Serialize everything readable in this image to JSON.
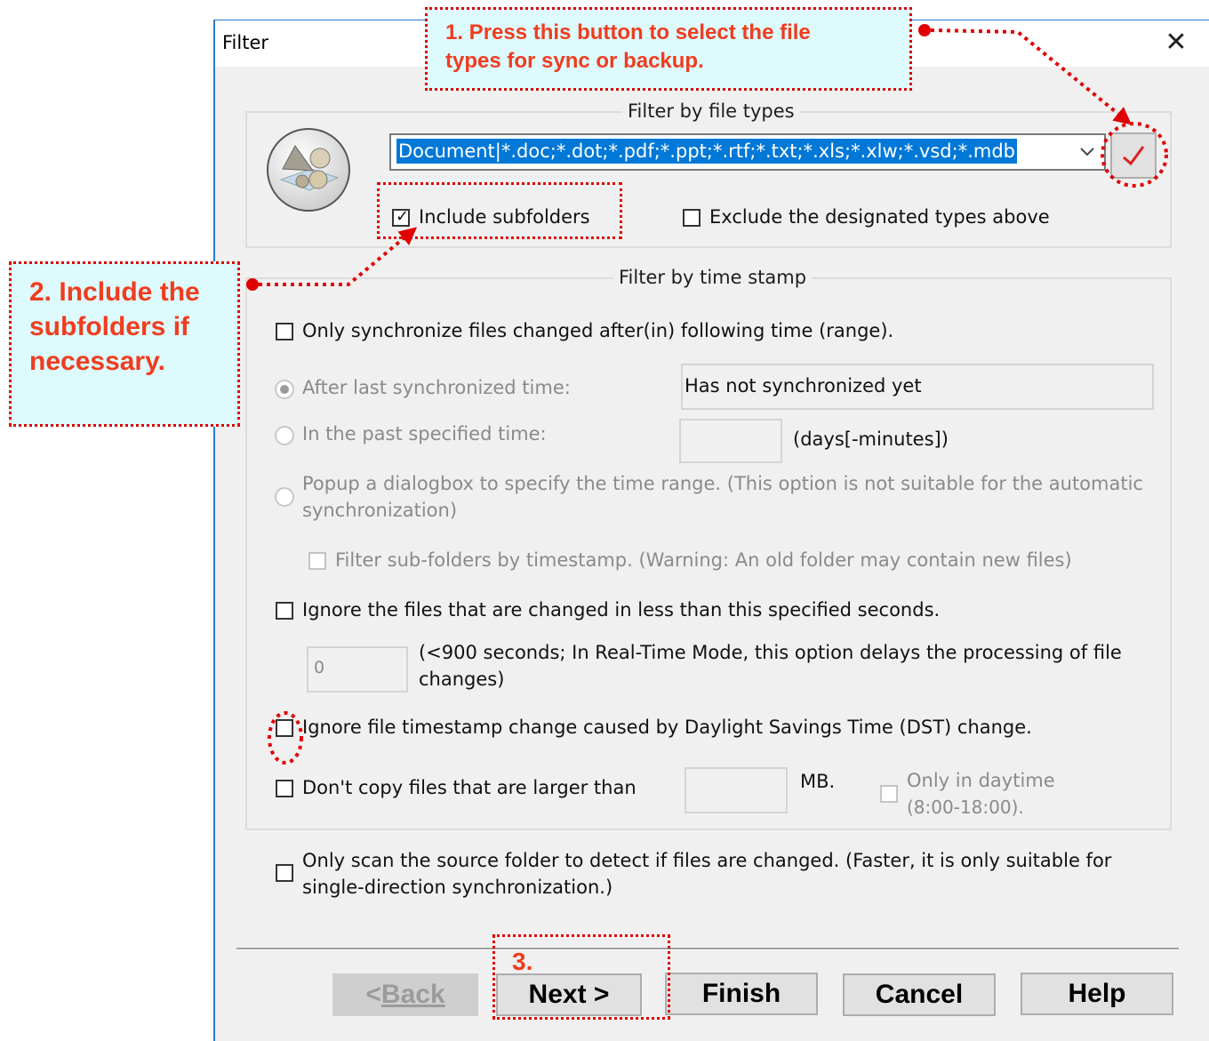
{
  "dialog": {
    "title": "Filter",
    "close_glyph": "✕",
    "file_types": {
      "group_label": "Filter by file types",
      "combo_value": "Document|*.doc;*.dot;*.pdf;*.ppt;*.rtf;*.txt;*.xls;*.xlw;*.vsd;*.mdb",
      "include_subfolders": "Include subfolders",
      "include_subfolders_checked": true,
      "exclude_types": "Exclude the designated types above",
      "exclude_types_checked": false
    },
    "time_stamp": {
      "group_label": "Filter by time stamp",
      "only_sync_changed": "Only synchronize files changed after(in) following time (range).",
      "after_last_sync": "After last synchronized time:",
      "last_sync_value": "Has not synchronized yet",
      "in_past": "In the past specified time:",
      "days_minutes": "(days[-minutes])",
      "popup_line1": "Popup a dialogbox to specify the time range. (This option is not suitable for the automatic",
      "popup_line2": "synchronization)",
      "filter_subfolders": "Filter sub-folders by timestamp. (Warning: An old folder may contain new files)",
      "ignore_seconds": "Ignore the files that are changed in less than this specified seconds.",
      "seconds_value": "0",
      "seconds_note_line1": "(<900 seconds; In Real-Time Mode, this option delays the processing of file",
      "seconds_note_line2": "changes)",
      "ignore_dst": "Ignore file timestamp change caused by Daylight Savings Time (DST) change.",
      "dont_copy_larger": "Don't copy files that are larger than",
      "mb_label": "MB.",
      "daytime_line1": "Only in daytime",
      "daytime_line2": "(8:00-18:00)."
    },
    "scan_source_line1": "Only scan the source folder to detect if files are changed. (Faster, it is only suitable for",
    "scan_source_line2": "single-direction synchronization.)",
    "buttons": {
      "back": "Back",
      "next": "Next >",
      "finish": "Finish",
      "cancel": "Cancel",
      "help": "Help"
    }
  },
  "annotations": {
    "callout1_line1": "1. Press this button to select the file",
    "callout1_line2": "types for sync or backup.",
    "callout2_line1": "2. Include the",
    "callout2_line2": "subfolders if",
    "callout2_line3": "necessary.",
    "callout3": "3."
  },
  "colors": {
    "accent": "#0078d7",
    "annotation_red": "#e00000",
    "annotation_text": "#f03c1f",
    "callout_bg": "#ddfafd"
  }
}
